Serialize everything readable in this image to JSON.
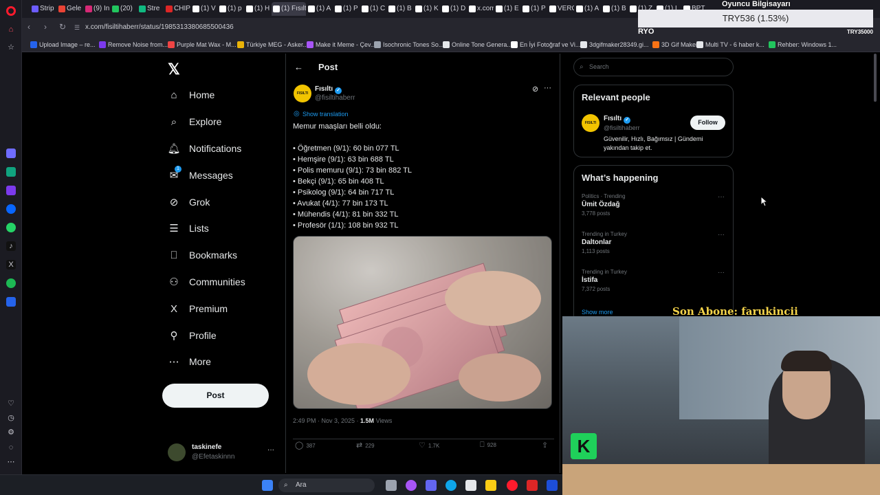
{
  "colors": {
    "x_blue": "#1d9bf0",
    "background": "#000000",
    "opera_red": "#ff1b2d",
    "brand_yellow": "#f2c400",
    "overlay_yellow": "#f5d44a"
  },
  "browser": {
    "tabs": [
      {
        "label": "Strip",
        "color": "#6c5cff"
      },
      {
        "label": "Gele",
        "color": "#ea4335"
      },
      {
        "label": "(9) In",
        "color": "#d62976"
      },
      {
        "label": "(20)",
        "color": "#22c55e"
      },
      {
        "label": "Stre",
        "color": "#10b981"
      },
      {
        "label": "CHIP",
        "color": "#dc2626"
      },
      {
        "label": "(1) V",
        "color": "#ffffff"
      },
      {
        "label": "(1) p",
        "color": "#ffffff"
      },
      {
        "label": "(1) H",
        "color": "#ffffff"
      },
      {
        "label": "(1) Fısıltı",
        "color": "#ffffff"
      },
      {
        "label": "(1) A",
        "color": "#ffffff"
      },
      {
        "label": "(1) P",
        "color": "#ffffff"
      },
      {
        "label": "(1) C",
        "color": "#ffffff"
      },
      {
        "label": "(1) B",
        "color": "#ffffff"
      },
      {
        "label": "(1) K",
        "color": "#ffffff"
      },
      {
        "label": "(1) D",
        "color": "#ffffff"
      },
      {
        "label": "x.com",
        "color": "#ffffff"
      },
      {
        "label": "(1) E",
        "color": "#ffffff"
      },
      {
        "label": "(1) P",
        "color": "#ffffff"
      },
      {
        "label": "VERC",
        "color": "#ffffff"
      },
      {
        "label": "(1) A",
        "color": "#ffffff"
      },
      {
        "label": "(1) B",
        "color": "#ffffff"
      },
      {
        "label": "(1) Z",
        "color": "#ffffff"
      },
      {
        "label": "(1) L",
        "color": "#ffffff"
      },
      {
        "label": "BPT",
        "color": "#ffffff"
      }
    ],
    "url": "x.com/fisiltihaberr/status/1985313380685500436",
    "bookmarks": [
      {
        "label": "Upload Image – re...",
        "color": "#2563eb"
      },
      {
        "label": "Remove Noise from...",
        "color": "#7c3aed"
      },
      {
        "label": "Purple Mat Wax - M...",
        "color": "#ef4444"
      },
      {
        "label": "Türkiye MEG - Asker...",
        "color": "#eab308"
      },
      {
        "label": "Make it Meme - Çev...",
        "color": "#a855f7"
      },
      {
        "label": "Isochronic Tones So...",
        "color": "#9ca3af"
      },
      {
        "label": "Online Tone Genera...",
        "color": "#e5e7eb"
      },
      {
        "label": "En İyi Fotoğraf ve Vi...",
        "color": "#ffffff"
      },
      {
        "label": "3dgifmaker28349.gi...",
        "color": "#e5e7eb"
      },
      {
        "label": "3D Gif Maker",
        "color": "#f97316"
      },
      {
        "label": "Multi TV - 6 haber k...",
        "color": "#e5e7eb"
      },
      {
        "label": "Rehber: Windows 1...",
        "color": "#22c55e"
      }
    ]
  },
  "stream": {
    "top_label": "Oyuncu Bilgisayarı",
    "ticker": "TRY536 (1.53%)",
    "ryo": "RYO",
    "try_small": "TRY35000",
    "son_abone": "Son Abone: farukincii"
  },
  "nav": {
    "items": [
      {
        "label": "Home",
        "icon": "home-icon"
      },
      {
        "label": "Explore",
        "icon": "search-icon"
      },
      {
        "label": "Notifications",
        "icon": "bell-icon"
      },
      {
        "label": "Messages",
        "icon": "mail-icon",
        "badge": "1"
      },
      {
        "label": "Grok",
        "icon": "grok-icon"
      },
      {
        "label": "Lists",
        "icon": "list-icon"
      },
      {
        "label": "Bookmarks",
        "icon": "bookmark-icon"
      },
      {
        "label": "Communities",
        "icon": "people-icon"
      },
      {
        "label": "Premium",
        "icon": "x-icon"
      },
      {
        "label": "Profile",
        "icon": "person-icon"
      },
      {
        "label": "More",
        "icon": "more-circle-icon"
      }
    ],
    "post_button": "Post",
    "account": {
      "name": "taskinefe",
      "handle": "@Efetaskinnn",
      "more": "···"
    }
  },
  "main": {
    "title": "Post",
    "author": {
      "name": "Fısıltı",
      "handle": "@fisiltihaberr",
      "avatar_text": "FISILTI"
    },
    "show_translation": "Show translation",
    "post_lines": [
      "Memur maaşları belli oldu:",
      "",
      "• Öğretmen (9/1): 60 bin 077 TL",
      "• Hemşire (9/1): 63 bin 688 TL",
      "• Polis memuru (9/1): 73 bin 882 TL",
      "• Bekçi (9/1): 65 bin 408 TL",
      "• Psikolog (9/1): 64 bin 717 TL",
      "• Avukat (4/1): 77 bin 173 TL",
      "• Mühendis (4/1): 81 bin 332 TL",
      "• Profesör (1/1): 108 bin 932 TL"
    ],
    "timestamp": "2:49 PM · Nov 3, 2025 · ",
    "views_count": "1.5M",
    "views_label": " Views",
    "stats": {
      "replies": "387",
      "reposts": "229",
      "likes": "1.7K",
      "bookmarks": "928"
    }
  },
  "sidebar": {
    "search_placeholder": "Search",
    "relevant_title": "Relevant people",
    "relevant": {
      "name": "Fısıltı",
      "handle": "@fisiltihaberr",
      "avatar_text": "FISILTI",
      "follow": "Follow",
      "bio": "Güvenilir, Hızlı, Bağımsız | Gündemi yakından takip et."
    },
    "happening_title": "What’s happening",
    "trends": [
      {
        "context": "Politics · Trending",
        "title": "Ümit Özdağ",
        "posts": "3,778 posts"
      },
      {
        "context": "Trending in Turkey",
        "title": "Daltonlar",
        "posts": "1,113 posts"
      },
      {
        "context": "Trending in Turkey",
        "title": "İstifa",
        "posts": "7,372 posts"
      }
    ],
    "show_more": "Show more"
  },
  "taskbar": {
    "search_label": "Ara"
  }
}
